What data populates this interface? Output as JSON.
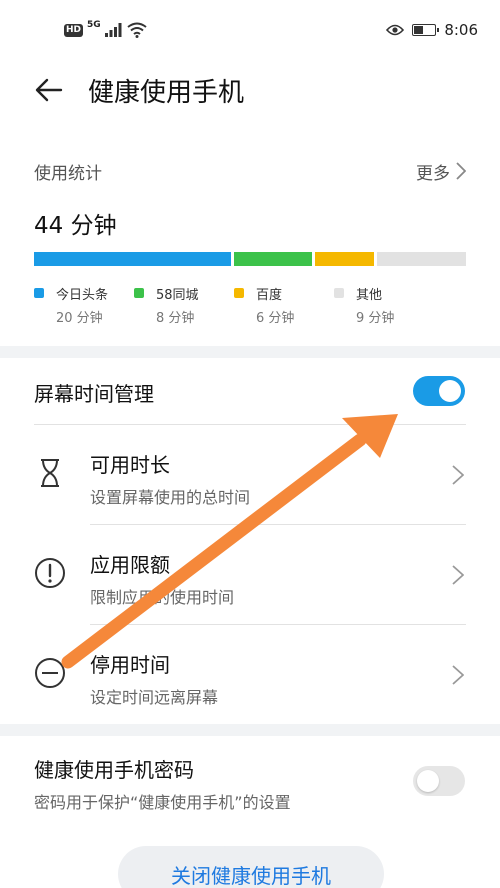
{
  "status_bar": {
    "hd": "HD",
    "network": "5G",
    "time": "8:06"
  },
  "header": {
    "title": "健康使用手机"
  },
  "stats": {
    "label": "使用统计",
    "more": "更多",
    "total": "44 分钟",
    "apps": [
      {
        "name": "今日头条",
        "time": "20 分钟",
        "minutes": 20,
        "color": "#1a9be6"
      },
      {
        "name": "58同城",
        "time": "8 分钟",
        "minutes": 8,
        "color": "#3cc24a"
      },
      {
        "name": "百度",
        "time": "6 分钟",
        "minutes": 6,
        "color": "#f5b800"
      },
      {
        "name": "其他",
        "time": "9 分钟",
        "minutes": 9,
        "color": "#e2e2e2"
      }
    ]
  },
  "screen_time": {
    "title": "屏幕时间管理",
    "enabled": true,
    "items": [
      {
        "title": "可用时长",
        "subtitle": "设置屏幕使用的总时间",
        "icon": "hourglass-icon"
      },
      {
        "title": "应用限额",
        "subtitle": "限制应用的使用时间",
        "icon": "exclamation-circle-icon"
      },
      {
        "title": "停用时间",
        "subtitle": "设定时间远离屏幕",
        "icon": "minus-circle-icon"
      }
    ]
  },
  "password": {
    "title": "健康使用手机密码",
    "subtitle": "密码用于保护“健康使用手机”的设置",
    "enabled": false
  },
  "close_button": "关闭健康使用手机",
  "colors": {
    "accent": "#1a9be6",
    "link": "#1f7ae0",
    "annotation": "#f5883a"
  }
}
